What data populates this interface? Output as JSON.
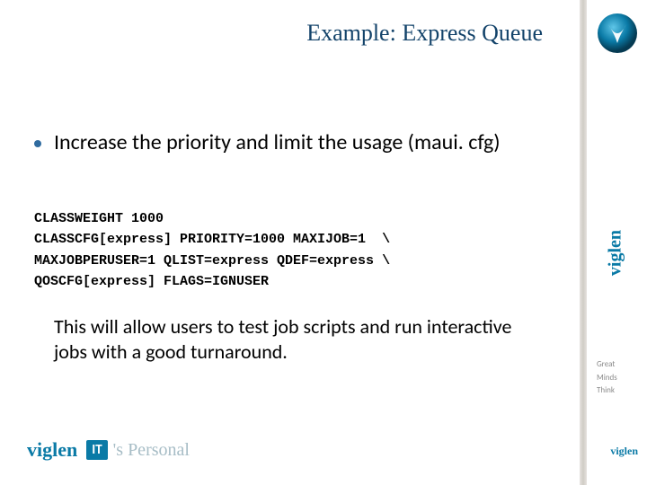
{
  "title": "Example: Express Queue",
  "bullet": "Increase the priority and limit the usage (maui. cfg)",
  "code": {
    "line1": "CLASSWEIGHT 1000",
    "line2": "CLASSCFG[express] PRIORITY=1000 MAXIJOB=1  \\",
    "line3": "MAXJOBPERUSER=1 QLIST=express QDEF=express \\",
    "line4": "QOSCFG[express] FLAGS=IGNUSER"
  },
  "summary": "This will allow users to test job scripts and run interactive jobs with a good turnaround.",
  "footer": {
    "brand": "viglen",
    "it": "IT",
    "apostrophe_s": "'s",
    "personal": "Personal"
  },
  "side": {
    "brand": "viglen",
    "tag1": "Great",
    "tag2": "Minds",
    "tag3": "Think",
    "mini": "viglen"
  }
}
